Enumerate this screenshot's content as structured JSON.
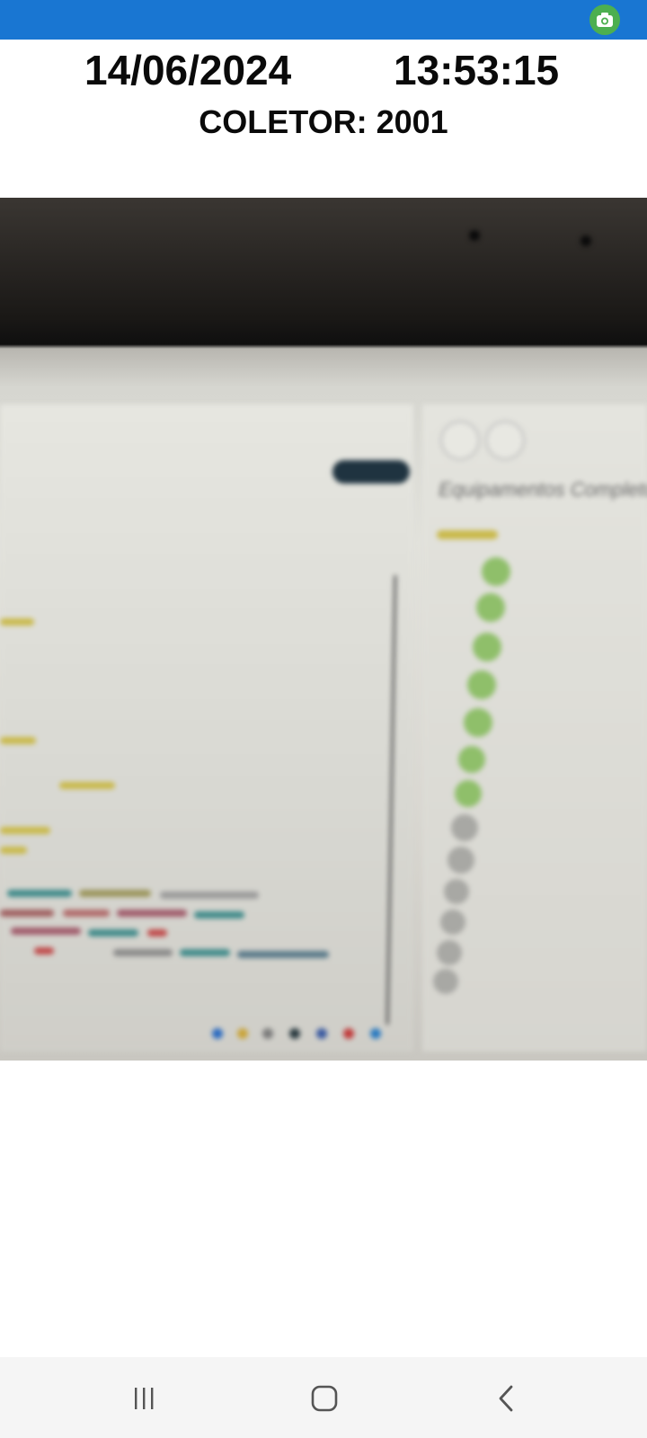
{
  "header": {
    "date": "14/06/2024",
    "time": "13:53:15",
    "collector": "COLETOR: 2001"
  },
  "photo": {
    "screen_title": "Equipamentos Completo"
  },
  "icons": {
    "camera": "camera-icon",
    "recents": "recent-apps-icon",
    "home": "home-icon",
    "back": "back-icon"
  },
  "colors": {
    "status_bar": "#1976d2",
    "camera_button": "#4caf50",
    "nav_bar": "#f5f5f5"
  }
}
